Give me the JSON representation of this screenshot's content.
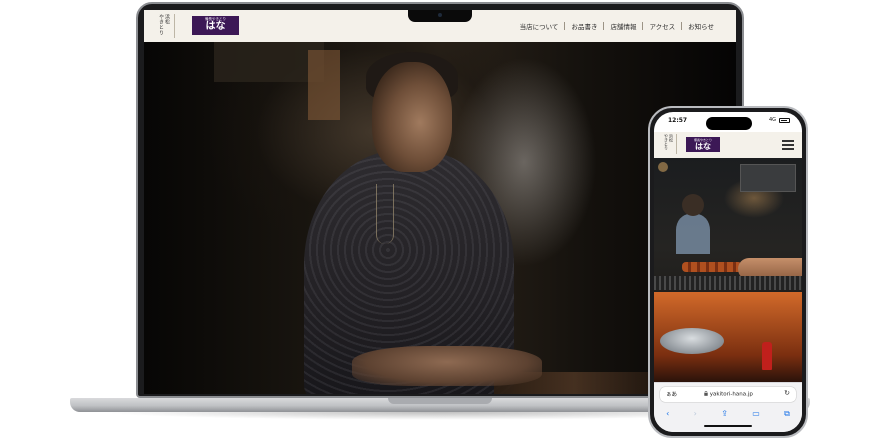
{
  "desktop": {
    "brand_vertical": [
      "浜松",
      "やきとり"
    ],
    "logo_small": "備長やきとり",
    "logo_main": "はな",
    "nav": [
      {
        "label": "当店について"
      },
      {
        "label": "お品書き"
      },
      {
        "label": "店舗情報"
      },
      {
        "label": "アクセス"
      },
      {
        "label": "お知らせ"
      }
    ]
  },
  "mobile": {
    "status_time": "12:57",
    "status_network": "4G",
    "brand_vertical": [
      "浜松",
      "やきとり"
    ],
    "logo_small": "備長やきとり",
    "logo_main": "はな",
    "url_aa": "ぁあ",
    "url": "yakitori-hana.jp",
    "toolbar": {
      "back": "‹",
      "forward": "›",
      "share": "⇪",
      "bookmarks": "▭",
      "tabs": "⧉"
    },
    "lock_icon": "lock-icon",
    "reload_icon": "↻"
  },
  "colors": {
    "brand_purple": "#3c1856",
    "header_bg": "#f4f1ea",
    "hero_dark": "#0d0b09"
  }
}
